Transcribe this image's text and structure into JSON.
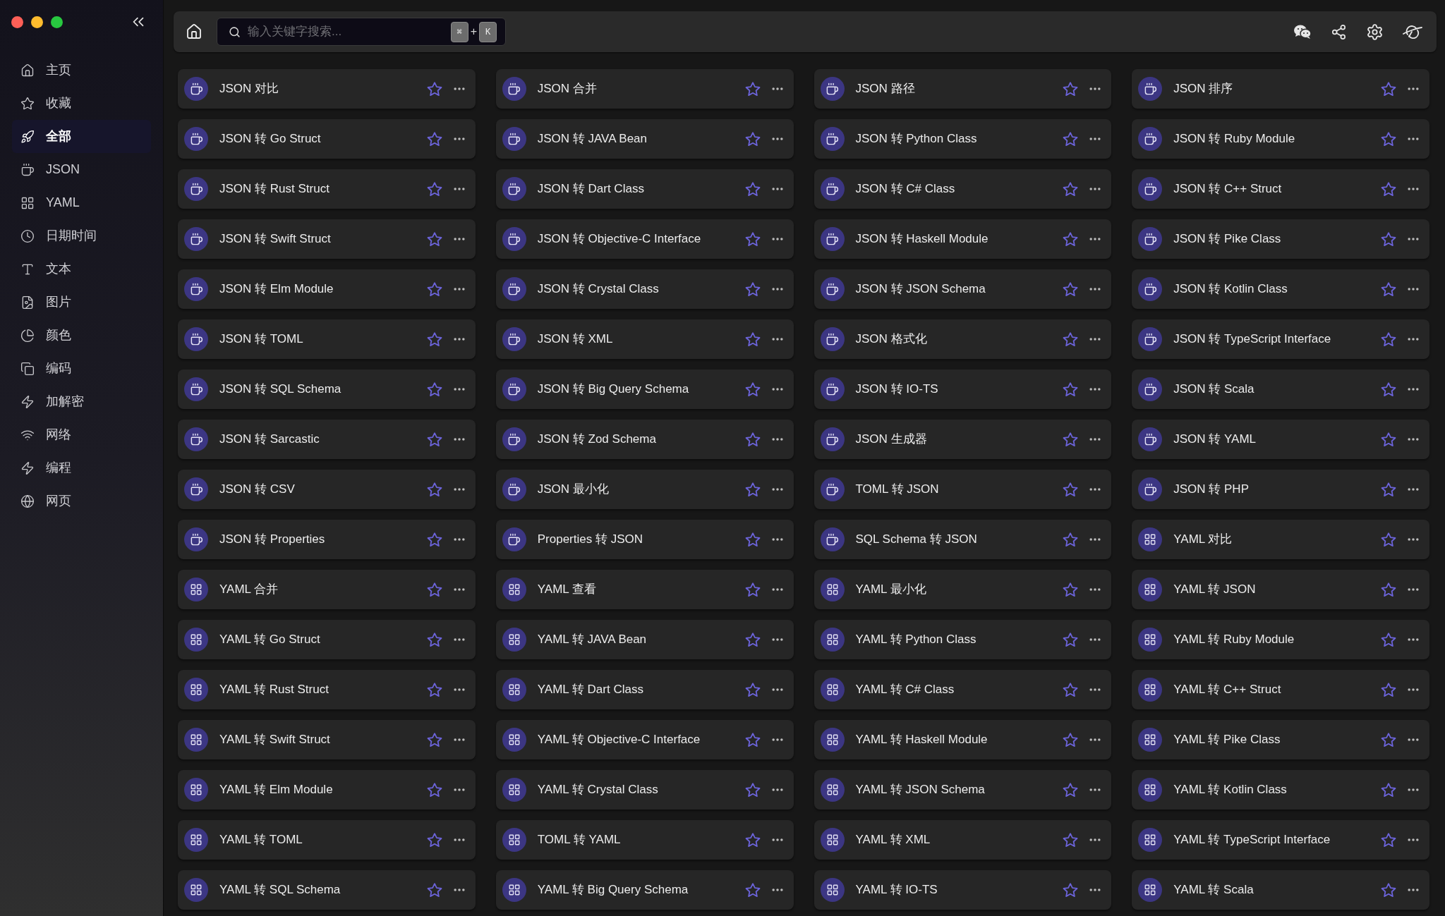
{
  "sidebar": {
    "items": [
      {
        "label": "主页",
        "selected": false
      },
      {
        "label": "收藏",
        "selected": false
      },
      {
        "label": "全部",
        "selected": true
      },
      {
        "label": "JSON",
        "selected": false
      },
      {
        "label": "YAML",
        "selected": false
      },
      {
        "label": "日期时间",
        "selected": false
      },
      {
        "label": "文本",
        "selected": false
      },
      {
        "label": "图片",
        "selected": false
      },
      {
        "label": "颜色",
        "selected": false
      },
      {
        "label": "编码",
        "selected": false
      },
      {
        "label": "加解密",
        "selected": false
      },
      {
        "label": "网络",
        "selected": false
      },
      {
        "label": "编程",
        "selected": false
      },
      {
        "label": "网页",
        "selected": false
      }
    ]
  },
  "toolbar": {
    "search": {
      "placeholder": "输入关键字搜索...",
      "shortcut": {
        "keys": [
          "⌘",
          "K"
        ],
        "separator": "+"
      }
    }
  },
  "tools": [
    {
      "label": "JSON 对比",
      "kind": "json",
      "starred": false
    },
    {
      "label": "JSON 合并",
      "kind": "json",
      "starred": false
    },
    {
      "label": "JSON 路径",
      "kind": "json",
      "starred": false
    },
    {
      "label": "JSON 排序",
      "kind": "json",
      "starred": false
    },
    {
      "label": "JSON 转 Go Struct",
      "kind": "json",
      "starred": false
    },
    {
      "label": "JSON 转 JAVA Bean",
      "kind": "json",
      "starred": false
    },
    {
      "label": "JSON 转 Python Class",
      "kind": "json",
      "starred": false
    },
    {
      "label": "JSON 转 Ruby Module",
      "kind": "json",
      "starred": false
    },
    {
      "label": "JSON 转 Rust Struct",
      "kind": "json",
      "starred": false
    },
    {
      "label": "JSON 转 Dart Class",
      "kind": "json",
      "starred": false
    },
    {
      "label": "JSON 转 C# Class",
      "kind": "json",
      "starred": false
    },
    {
      "label": "JSON 转 C++ Struct",
      "kind": "json",
      "starred": false
    },
    {
      "label": "JSON 转 Swift Struct",
      "kind": "json",
      "starred": false
    },
    {
      "label": "JSON 转 Objective-C Interface",
      "kind": "json",
      "starred": false
    },
    {
      "label": "JSON 转 Haskell Module",
      "kind": "json",
      "starred": false
    },
    {
      "label": "JSON 转 Pike Class",
      "kind": "json",
      "starred": false
    },
    {
      "label": "JSON 转 Elm Module",
      "kind": "json",
      "starred": false
    },
    {
      "label": "JSON 转 Crystal Class",
      "kind": "json",
      "starred": false
    },
    {
      "label": "JSON 转 JSON Schema",
      "kind": "json",
      "starred": false
    },
    {
      "label": "JSON 转 Kotlin Class",
      "kind": "json",
      "starred": false
    },
    {
      "label": "JSON 转 TOML",
      "kind": "json",
      "starred": false
    },
    {
      "label": "JSON 转 XML",
      "kind": "json",
      "starred": false
    },
    {
      "label": "JSON 格式化",
      "kind": "json",
      "starred": false
    },
    {
      "label": "JSON 转 TypeScript Interface",
      "kind": "json",
      "starred": false
    },
    {
      "label": "JSON 转 SQL Schema",
      "kind": "json",
      "starred": false
    },
    {
      "label": "JSON 转 Big Query Schema",
      "kind": "json",
      "starred": false
    },
    {
      "label": "JSON 转 IO-TS",
      "kind": "json",
      "starred": false
    },
    {
      "label": "JSON 转 Scala",
      "kind": "json",
      "starred": false
    },
    {
      "label": "JSON 转 Sarcastic",
      "kind": "json",
      "starred": false
    },
    {
      "label": "JSON 转 Zod Schema",
      "kind": "json",
      "starred": false
    },
    {
      "label": "JSON 生成器",
      "kind": "json",
      "starred": false
    },
    {
      "label": "JSON 转 YAML",
      "kind": "json",
      "starred": false
    },
    {
      "label": "JSON 转 CSV",
      "kind": "json",
      "starred": false
    },
    {
      "label": "JSON 最小化",
      "kind": "json",
      "starred": false
    },
    {
      "label": "TOML 转 JSON",
      "kind": "json",
      "starred": false
    },
    {
      "label": "JSON 转 PHP",
      "kind": "json",
      "starred": false
    },
    {
      "label": "JSON 转 Properties",
      "kind": "json",
      "starred": false
    },
    {
      "label": "Properties 转 JSON",
      "kind": "json",
      "starred": false
    },
    {
      "label": "SQL Schema 转 JSON",
      "kind": "json",
      "starred": false
    },
    {
      "label": "YAML 对比",
      "kind": "yaml",
      "starred": false
    },
    {
      "label": "YAML 合并",
      "kind": "yaml",
      "starred": false
    },
    {
      "label": "YAML 查看",
      "kind": "yaml",
      "starred": false
    },
    {
      "label": "YAML 最小化",
      "kind": "yaml",
      "starred": false
    },
    {
      "label": "YAML 转 JSON",
      "kind": "yaml",
      "starred": false
    },
    {
      "label": "YAML 转 Go Struct",
      "kind": "yaml",
      "starred": false
    },
    {
      "label": "YAML 转 JAVA Bean",
      "kind": "yaml",
      "starred": false
    },
    {
      "label": "YAML 转 Python Class",
      "kind": "yaml",
      "starred": false
    },
    {
      "label": "YAML 转 Ruby Module",
      "kind": "yaml",
      "starred": false
    },
    {
      "label": "YAML 转 Rust Struct",
      "kind": "yaml",
      "starred": false
    },
    {
      "label": "YAML 转 Dart Class",
      "kind": "yaml",
      "starred": false
    },
    {
      "label": "YAML 转 C# Class",
      "kind": "yaml",
      "starred": false
    },
    {
      "label": "YAML 转 C++ Struct",
      "kind": "yaml",
      "starred": false
    },
    {
      "label": "YAML 转 Swift Struct",
      "kind": "yaml",
      "starred": false
    },
    {
      "label": "YAML 转 Objective-C Interface",
      "kind": "yaml",
      "starred": false
    },
    {
      "label": "YAML 转 Haskell Module",
      "kind": "yaml",
      "starred": false
    },
    {
      "label": "YAML 转 Pike Class",
      "kind": "yaml",
      "starred": false
    },
    {
      "label": "YAML 转 Elm Module",
      "kind": "yaml",
      "starred": false
    },
    {
      "label": "YAML 转 Crystal Class",
      "kind": "yaml",
      "starred": false
    },
    {
      "label": "YAML 转 JSON Schema",
      "kind": "yaml",
      "starred": false
    },
    {
      "label": "YAML 转 Kotlin Class",
      "kind": "yaml",
      "starred": false
    },
    {
      "label": "YAML 转 TOML",
      "kind": "yaml",
      "starred": false
    },
    {
      "label": "TOML 转 YAML",
      "kind": "yaml",
      "starred": false
    },
    {
      "label": "YAML 转 XML",
      "kind": "yaml",
      "starred": false
    },
    {
      "label": "YAML 转 TypeScript Interface",
      "kind": "yaml",
      "starred": false
    },
    {
      "label": "YAML 转 SQL Schema",
      "kind": "yaml",
      "starred": false
    },
    {
      "label": "YAML 转 Big Query Schema",
      "kind": "yaml",
      "starred": false
    },
    {
      "label": "YAML 转 IO-TS",
      "kind": "yaml",
      "starred": false
    },
    {
      "label": "YAML 转 Scala",
      "kind": "yaml",
      "starred": false
    }
  ]
}
